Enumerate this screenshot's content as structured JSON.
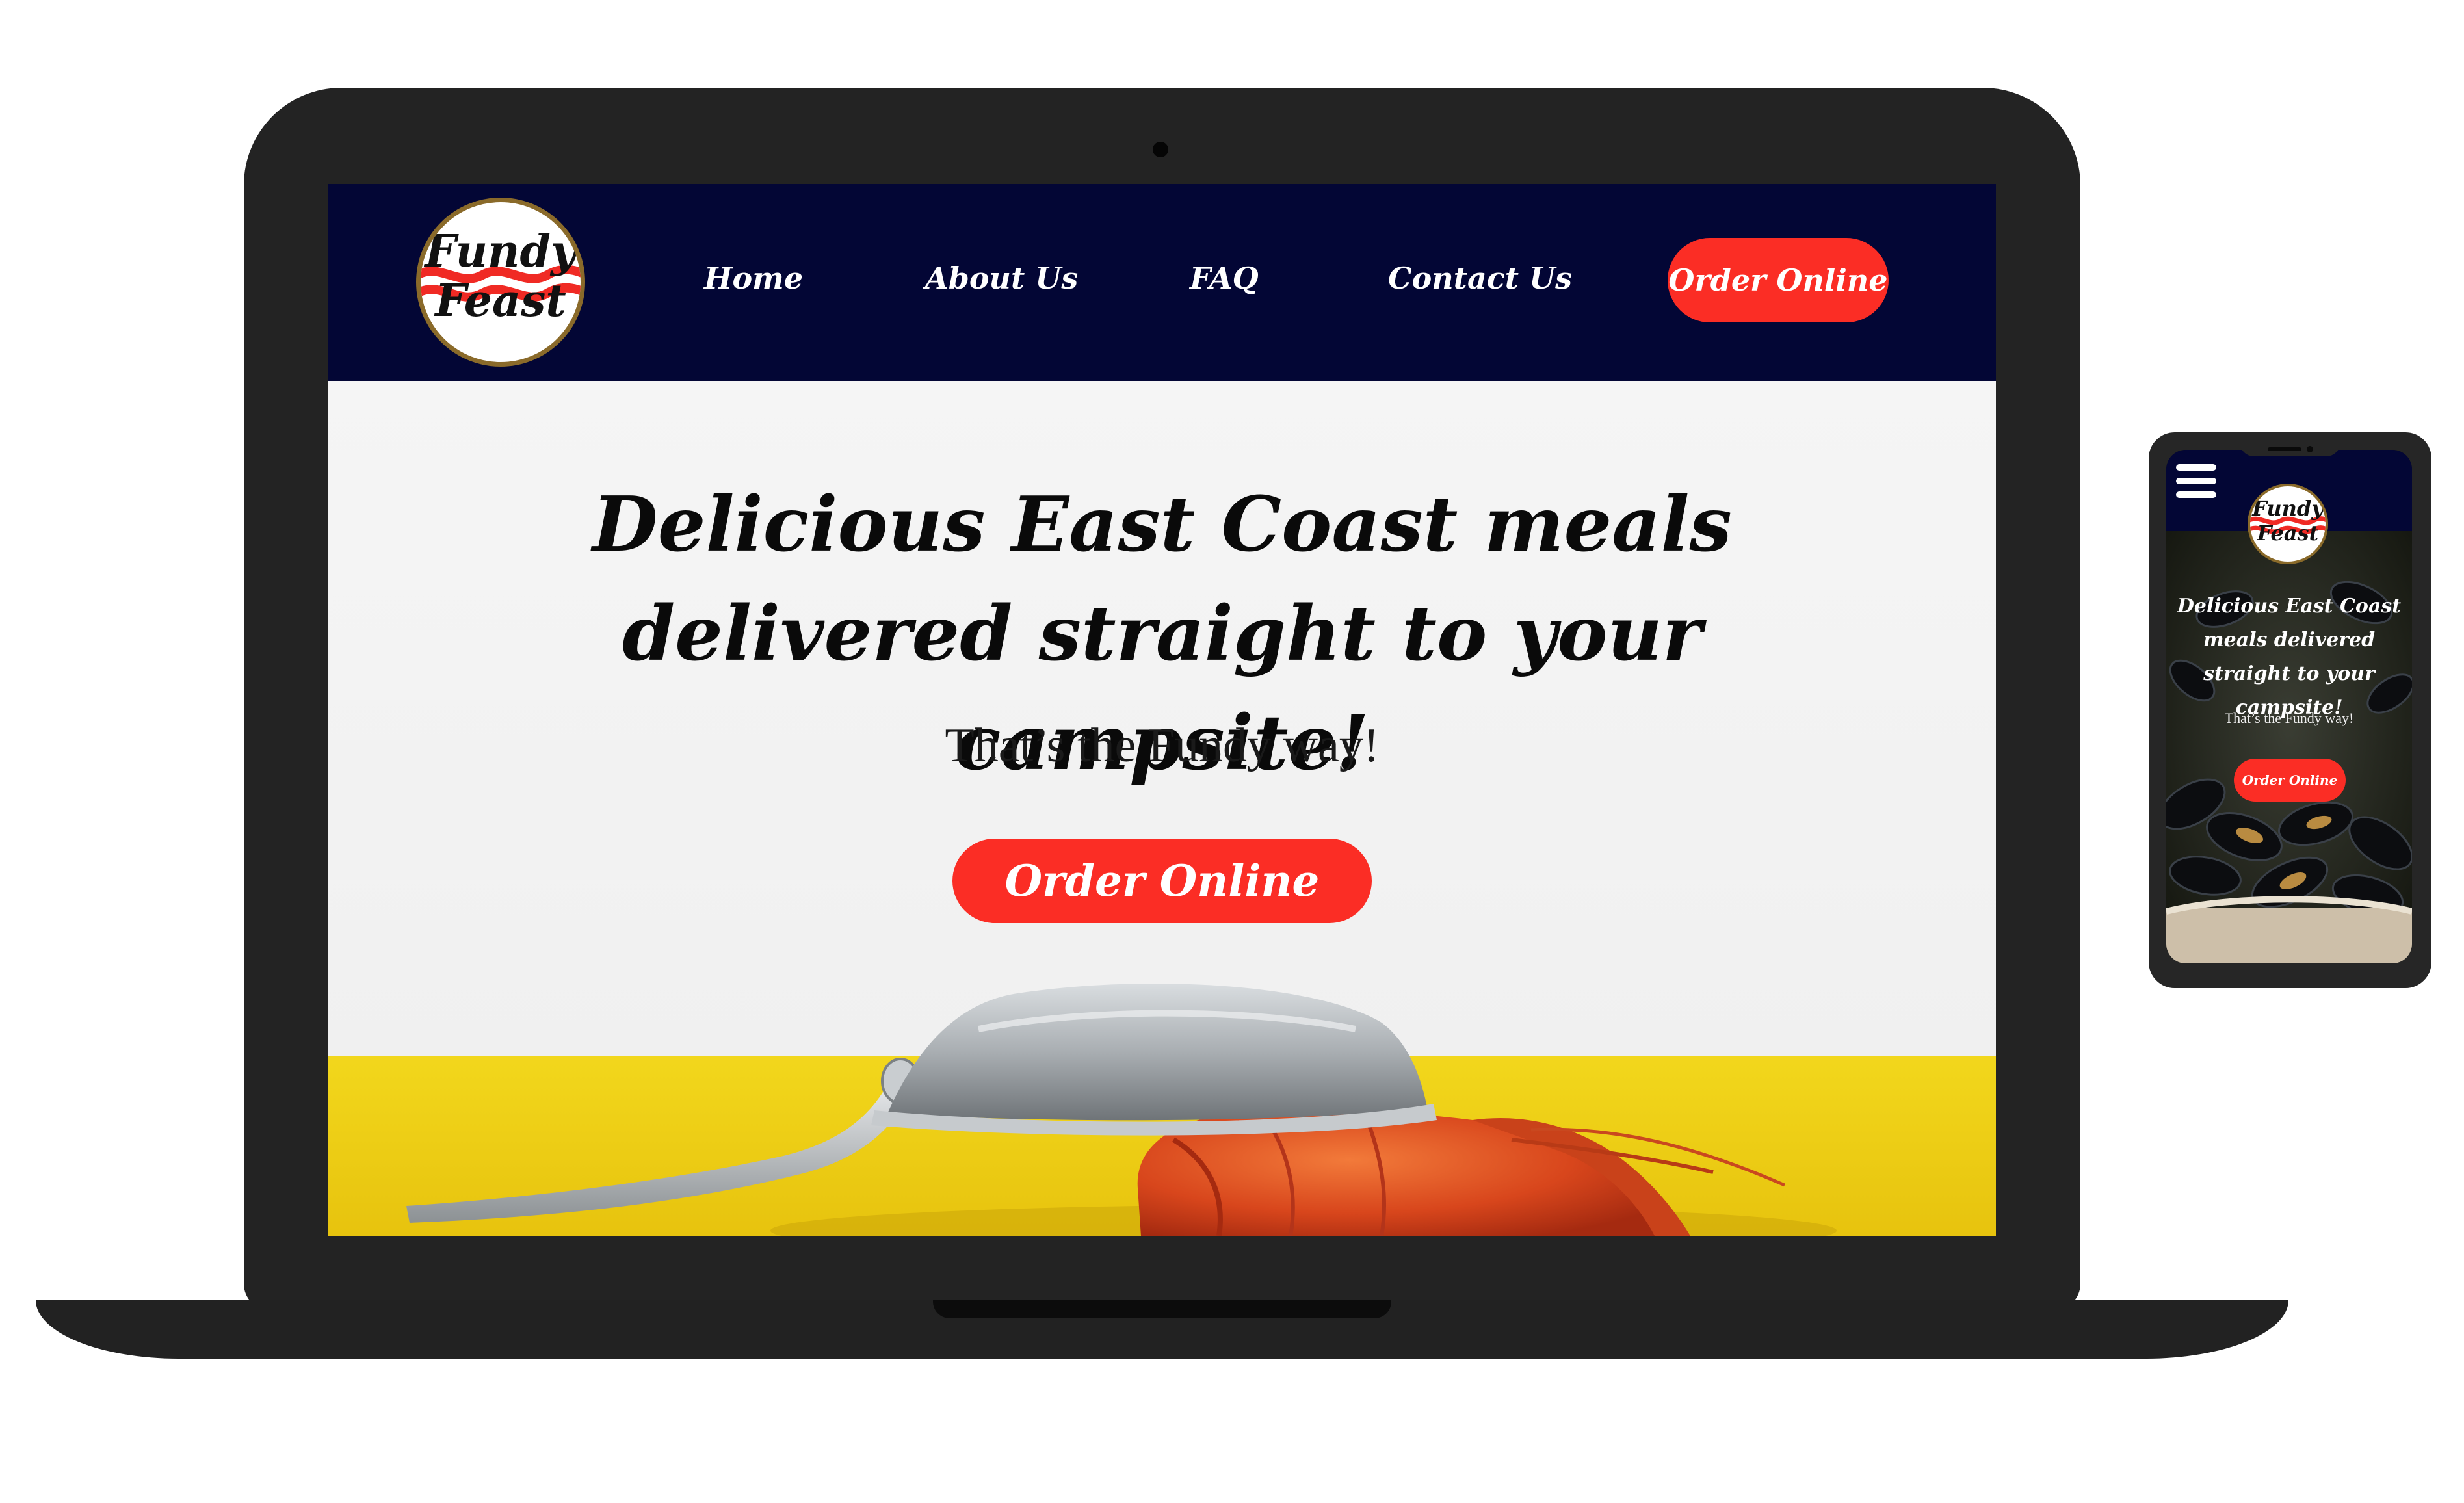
{
  "brand": {
    "name_line1": "Fundy",
    "name_line2": "Feast"
  },
  "nav": {
    "items": [
      {
        "label": "Home"
      },
      {
        "label": "About Us"
      },
      {
        "label": "FAQ"
      },
      {
        "label": "Contact Us"
      }
    ],
    "order_label": "Order Online"
  },
  "hero": {
    "title": "Delicious East Coast meals delivered straight to your campsite!",
    "subtitle": "That’s the Fundy way!",
    "order_label": "Order Online"
  },
  "mobile": {
    "menu_icon": "hamburger-icon",
    "title": "Delicious East Coast meals delivered straight to your campsite!",
    "subtitle": "That’s the Fundy way!",
    "order_label": "Order Online"
  },
  "colors": {
    "navbar": "#030635",
    "accent": "#fb2d25",
    "device": "#232323",
    "table_yellow": "#f1d21a"
  }
}
